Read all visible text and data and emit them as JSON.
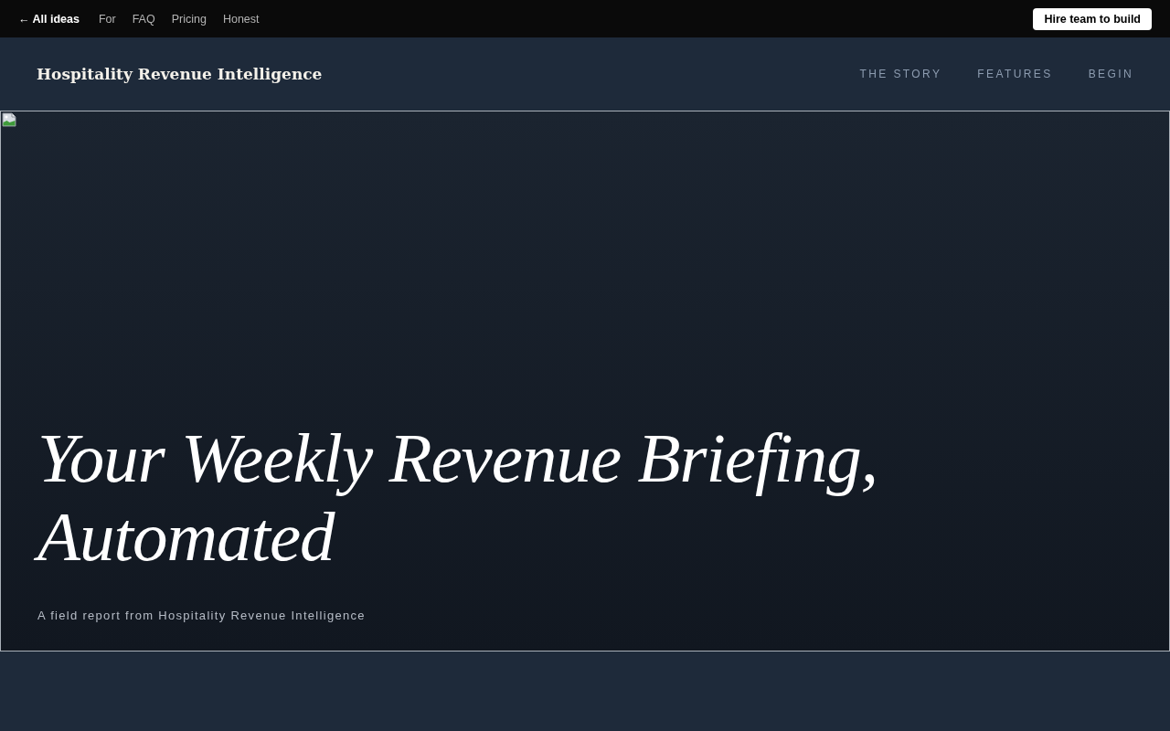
{
  "top_bar": {
    "back_link": "← All ideas",
    "links": [
      "For",
      "FAQ",
      "Pricing",
      "Honest"
    ],
    "cta": "Hire team to build"
  },
  "header": {
    "brand": "Hospitality Revenue Intelligence",
    "nav": [
      "THE STORY",
      "FEATURES",
      "BEGIN"
    ]
  },
  "hero": {
    "title": "Your Weekly Revenue Briefing, Automated",
    "subtitle": "A field report from Hospitality Revenue Intelligence"
  }
}
